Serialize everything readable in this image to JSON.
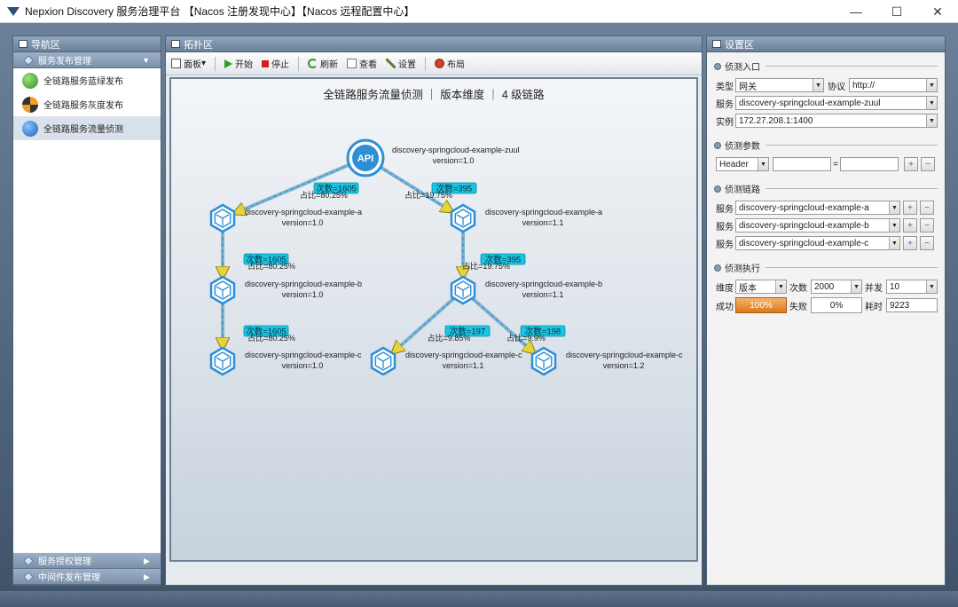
{
  "window": {
    "title": "Nepxion Discovery 服务治理平台 【Nacos 注册发现中心】【Nacos 远程配置中心】",
    "minimize": "—",
    "maximize": "☐",
    "close": "✕"
  },
  "nav": {
    "header": "导航区",
    "group_top": "服务发布管理",
    "items": [
      {
        "label": "全链路服务蓝绿发布"
      },
      {
        "label": "全链路服务灰度发布"
      },
      {
        "label": "全链路服务流量侦测"
      }
    ],
    "groups_bottom": [
      {
        "label": "服务授权管理"
      },
      {
        "label": "中间件发布管理"
      }
    ]
  },
  "topo": {
    "header": "拓扑区",
    "toolbar": {
      "panel": "面板",
      "start": "开始",
      "stop": "停止",
      "refresh": "刷新",
      "view": "查看",
      "settings": "设置",
      "layout": "布局"
    },
    "canvas_title": "全链路服务流量侦测 ｜ 版本维度 ｜ 4 级链路",
    "nodes": [
      {
        "id": "zuul",
        "name": "discovery-springcloud-example-zuul",
        "version": "version=1.0",
        "api": "API"
      },
      {
        "id": "a10",
        "name": "discovery-springcloud-example-a",
        "version": "version=1.0"
      },
      {
        "id": "a11",
        "name": "discovery-springcloud-example-a",
        "version": "version=1.1"
      },
      {
        "id": "b10",
        "name": "discovery-springcloud-example-b",
        "version": "version=1.0"
      },
      {
        "id": "b11",
        "name": "discovery-springcloud-example-b",
        "version": "version=1.1"
      },
      {
        "id": "c10",
        "name": "discovery-springcloud-example-c",
        "version": "version=1.0"
      },
      {
        "id": "c11",
        "name": "discovery-springcloud-example-c",
        "version": "version=1.1"
      },
      {
        "id": "c12",
        "name": "discovery-springcloud-example-c",
        "version": "version=1.2"
      }
    ],
    "edges": [
      {
        "from": "zuul",
        "to": "a10",
        "count": "次数=1605",
        "ratio": "占比=80.25%"
      },
      {
        "from": "zuul",
        "to": "a11",
        "count": "次数=395",
        "ratio": "占比=19.75%"
      },
      {
        "from": "a10",
        "to": "b10",
        "count": "次数=1605",
        "ratio": "占比=80.25%"
      },
      {
        "from": "a11",
        "to": "b11",
        "count": "次数=395",
        "ratio": "占比=19.75%"
      },
      {
        "from": "b10",
        "to": "c10",
        "count": "次数=1605",
        "ratio": "占比=80.25%"
      },
      {
        "from": "b11",
        "to": "c11",
        "count": "次数=197",
        "ratio": "占比=9.85%"
      },
      {
        "from": "b11",
        "to": "c12",
        "count": "次数=198",
        "ratio": "占比=9.9%"
      }
    ]
  },
  "settings": {
    "header": "设置区",
    "entry": {
      "title": "侦测入口",
      "type_label": "类型",
      "type_value": "网关",
      "protocol_label": "协议",
      "protocol_value": "http://",
      "service_label": "服务",
      "service_value": "discovery-springcloud-example-zuul",
      "instance_label": "实例",
      "instance_value": "172.27.208.1:1400"
    },
    "params": {
      "title": "侦测参数",
      "param_type": "Header",
      "key": "",
      "eq": "=",
      "value": "",
      "add": "+",
      "remove": "−"
    },
    "chain": {
      "title": "侦测链路",
      "rows": [
        {
          "label": "服务",
          "value": "discovery-springcloud-example-a"
        },
        {
          "label": "服务",
          "value": "discovery-springcloud-example-b"
        },
        {
          "label": "服务",
          "value": "discovery-springcloud-example-c"
        }
      ]
    },
    "exec": {
      "title": "侦测执行",
      "dimension_label": "维度",
      "dimension_value": "版本",
      "times_label": "次数",
      "times_value": "2000",
      "concurrency_label": "并发",
      "concurrency_value": "10",
      "success_label": "成功",
      "success_value": "100%",
      "fail_label": "失败",
      "fail_value": "0%",
      "elapsed_label": "耗时",
      "elapsed_value": "9223"
    }
  },
  "colors": {
    "node": "#2e8fd6",
    "label_bg": "#19c5e3",
    "edge": "#5aa0c8",
    "success": "#d9791e"
  }
}
